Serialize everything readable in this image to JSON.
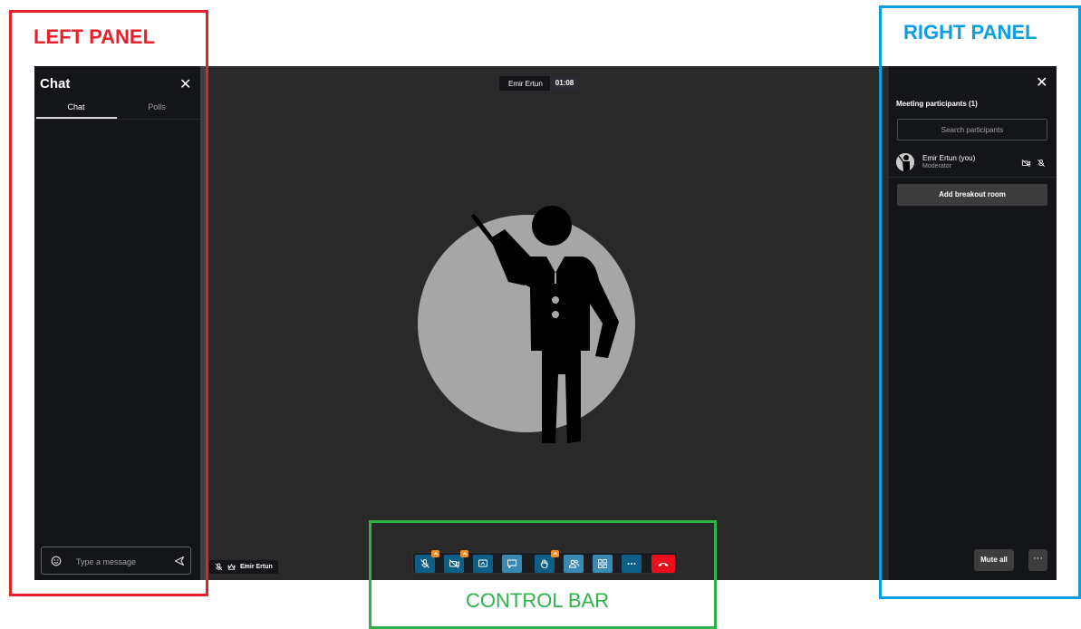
{
  "annotations": {
    "left_panel": "LEFT PANEL",
    "right_panel": "RIGHT PANEL",
    "control_bar": "CONTROL BAR",
    "colors": {
      "left": "#e8202c",
      "right": "#0e9ee0",
      "control": "#2eb34b"
    }
  },
  "chat": {
    "title": "Chat",
    "close_icon": "close-icon",
    "tabs": [
      {
        "label": "Chat",
        "active": true
      },
      {
        "label": "Polls",
        "active": false
      }
    ],
    "input_placeholder": "Type a message",
    "emoji_icon": "emoji-icon",
    "send_icon": "send-icon"
  },
  "header": {
    "name": "Emir Ertun",
    "time": "01:08"
  },
  "stage": {
    "name_tag": "Emir Ertun",
    "avatar_icon": "presenter-avatar"
  },
  "participants": {
    "heading": "Meeting participants (1)",
    "search_placeholder": "Search participants",
    "list": [
      {
        "name": "Emir Ertun (you)",
        "role": "Moderator"
      }
    ],
    "breakout_label": "Add breakout room",
    "mute_all_label": "Mute all",
    "more_label": "···"
  },
  "toolbar": {
    "buttons": [
      {
        "id": "microphone",
        "icon": "mic-off-icon",
        "badge": true
      },
      {
        "id": "camera",
        "icon": "camera-off-icon",
        "badge": true
      },
      {
        "id": "share-screen",
        "icon": "screen-share-icon",
        "badge": false
      },
      {
        "id": "chat",
        "icon": "chat-icon",
        "badge": false,
        "active": true
      },
      {
        "id": "raise-hand",
        "icon": "raise-hand-icon",
        "badge": true
      },
      {
        "id": "participants",
        "icon": "participants-icon",
        "badge": false,
        "active": true
      },
      {
        "id": "tile-view",
        "icon": "tile-view-icon",
        "badge": false
      },
      {
        "id": "more",
        "icon": "more-icon",
        "badge": false
      },
      {
        "id": "hangup",
        "icon": "hangup-icon",
        "badge": false
      }
    ],
    "colors": {
      "primary": "#0e5f87",
      "active": "#3a88b4",
      "hangup": "#e9101c",
      "badge": "#f28e2b"
    }
  }
}
